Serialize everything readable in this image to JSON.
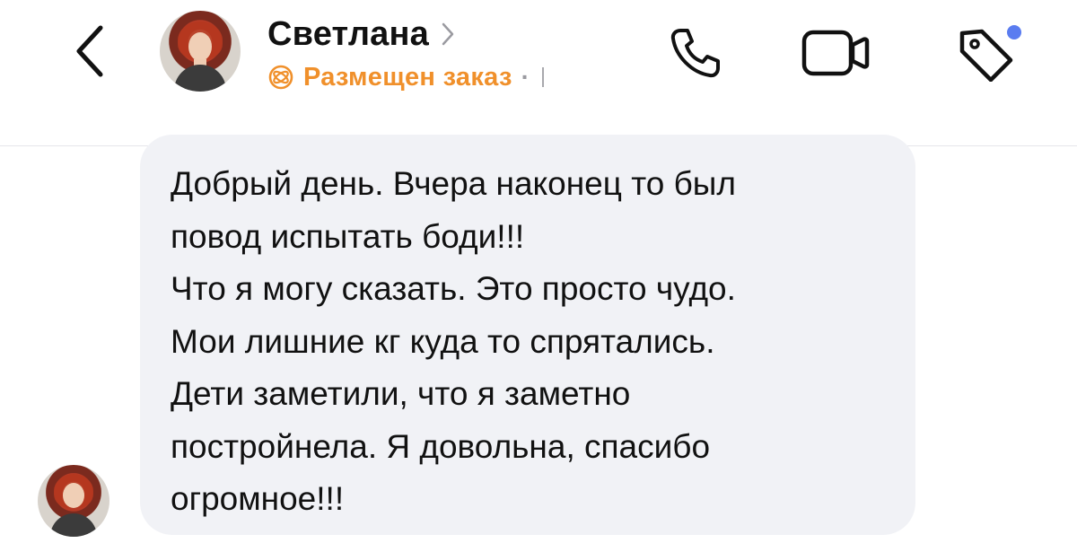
{
  "header": {
    "back_icon": "chevron-left-icon",
    "contact_name": "Светлана",
    "name_chevron_icon": "chevron-right-icon",
    "status_icon": "order-icon",
    "status_text": "Размещен заказ",
    "status_separator": "·",
    "actions": [
      {
        "name": "phone-icon"
      },
      {
        "name": "video-call-icon"
      },
      {
        "name": "tag-icon"
      }
    ],
    "tag_badge_color": "#5a7cf0",
    "status_color": "#f0902b"
  },
  "message": {
    "lines": [
      "Добрый день. Вчера наконец то был",
      "повод испытать боди!!!",
      "Что я могу сказать. Это просто чудо.",
      "Мои лишние кг куда то спрятались.",
      "Дети заметили, что я заметно",
      "постройнела. Я довольна, спасибо",
      "огромное!!!"
    ],
    "bubble_color": "#f1f2f6"
  }
}
